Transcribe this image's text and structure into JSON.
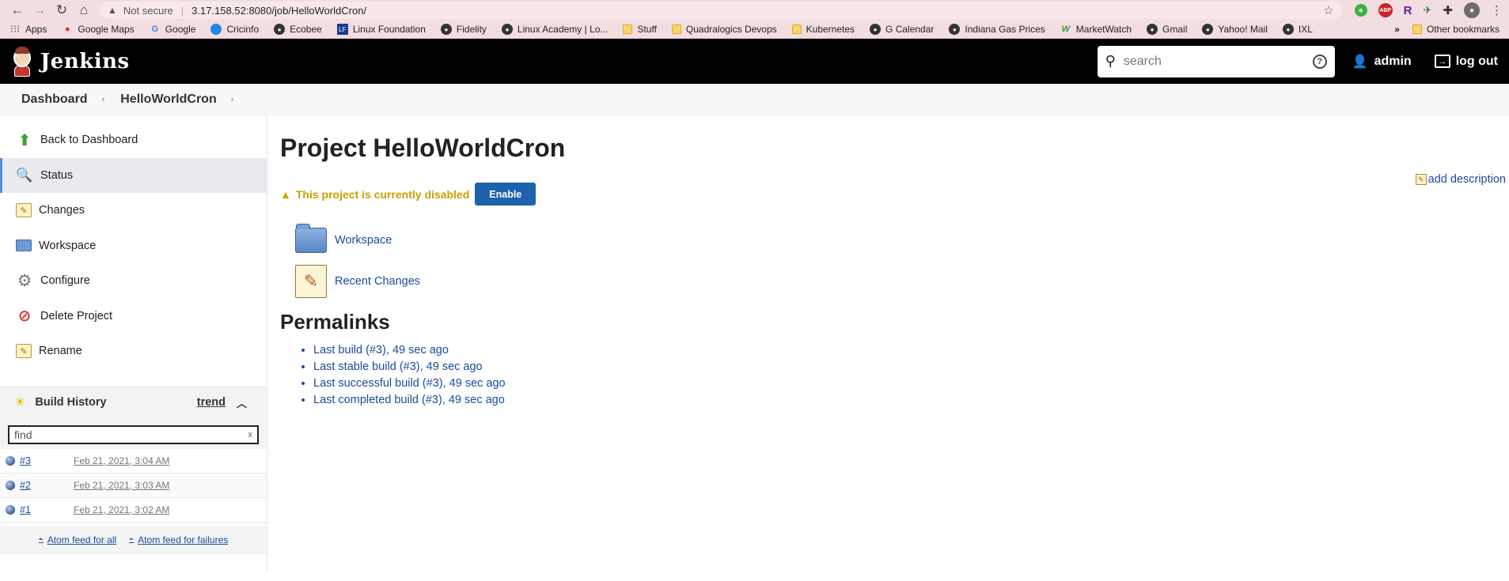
{
  "browser": {
    "not_secure_label": "Not secure",
    "url": "3.17.158.52:8080/job/HelloWorldCron/",
    "bookmarks": [
      {
        "label": "Apps",
        "icon": "grid"
      },
      {
        "label": "Google Maps",
        "icon": "pin"
      },
      {
        "label": "Google",
        "icon": "g"
      },
      {
        "label": "Cricinfo",
        "icon": "blue"
      },
      {
        "label": "Ecobee",
        "icon": "globe"
      },
      {
        "label": "Linux Foundation",
        "icon": "lf"
      },
      {
        "label": "Fidelity",
        "icon": "globe"
      },
      {
        "label": "Linux Academy | Lo...",
        "icon": "globe"
      },
      {
        "label": "Stuff",
        "icon": "folder"
      },
      {
        "label": "Quadralogics Devops",
        "icon": "folder"
      },
      {
        "label": "Kubernetes",
        "icon": "folder"
      },
      {
        "label": "G Calendar",
        "icon": "globe"
      },
      {
        "label": "Indiana Gas Prices",
        "icon": "globe"
      },
      {
        "label": "MarketWatch",
        "icon": "mw"
      },
      {
        "label": "Gmail",
        "icon": "globe"
      },
      {
        "label": "Yahoo! Mail",
        "icon": "globe"
      },
      {
        "label": "IXL",
        "icon": "globe"
      }
    ],
    "more": "»",
    "other_bookmarks": "Other bookmarks"
  },
  "header": {
    "logo_text": "Jenkins",
    "search_placeholder": "search",
    "help": "?",
    "user": "admin",
    "logout": "log out"
  },
  "breadcrumb": [
    "Dashboard",
    "HelloWorldCron"
  ],
  "sidebar": {
    "tasks": [
      {
        "label": "Back to Dashboard",
        "icon": "up-arrow-icon",
        "active": false
      },
      {
        "label": "Status",
        "icon": "magnifier-icon",
        "active": true
      },
      {
        "label": "Changes",
        "icon": "notepad-icon",
        "active": false
      },
      {
        "label": "Workspace",
        "icon": "folder-icon",
        "active": false
      },
      {
        "label": "Configure",
        "icon": "gear-icon",
        "active": false
      },
      {
        "label": "Delete Project",
        "icon": "no-entry-icon",
        "active": false
      },
      {
        "label": "Rename",
        "icon": "notepad-icon",
        "active": false
      }
    ],
    "build_history": {
      "title": "Build History",
      "trend": "trend",
      "find_placeholder": "find",
      "clear": "x",
      "builds": [
        {
          "number": "#3",
          "date": "Feb 21, 2021, 3:04 AM"
        },
        {
          "number": "#2",
          "date": "Feb 21, 2021, 3:03 AM"
        },
        {
          "number": "#1",
          "date": "Feb 21, 2021, 3:02 AM"
        }
      ],
      "atom_all": "Atom feed for all",
      "atom_failures": "Atom feed for failures"
    }
  },
  "main": {
    "title": "Project HelloWorldCron",
    "add_description": "add description",
    "disabled_message": "This project is currently disabled",
    "enable_button": "Enable",
    "project_links": [
      "Workspace",
      "Recent Changes"
    ],
    "permalinks_heading": "Permalinks",
    "permalinks": [
      "Last build (#3), 49 sec ago",
      "Last stable build (#3), 49 sec ago",
      "Last successful build (#3), 49 sec ago",
      "Last completed build (#3), 49 sec ago"
    ]
  },
  "colors": {
    "header_bg": "#000000",
    "link": "#1a4b9c",
    "warning": "#c79f00",
    "enable_button": "#1d62ad",
    "browser_chrome": "#f2dde0"
  }
}
